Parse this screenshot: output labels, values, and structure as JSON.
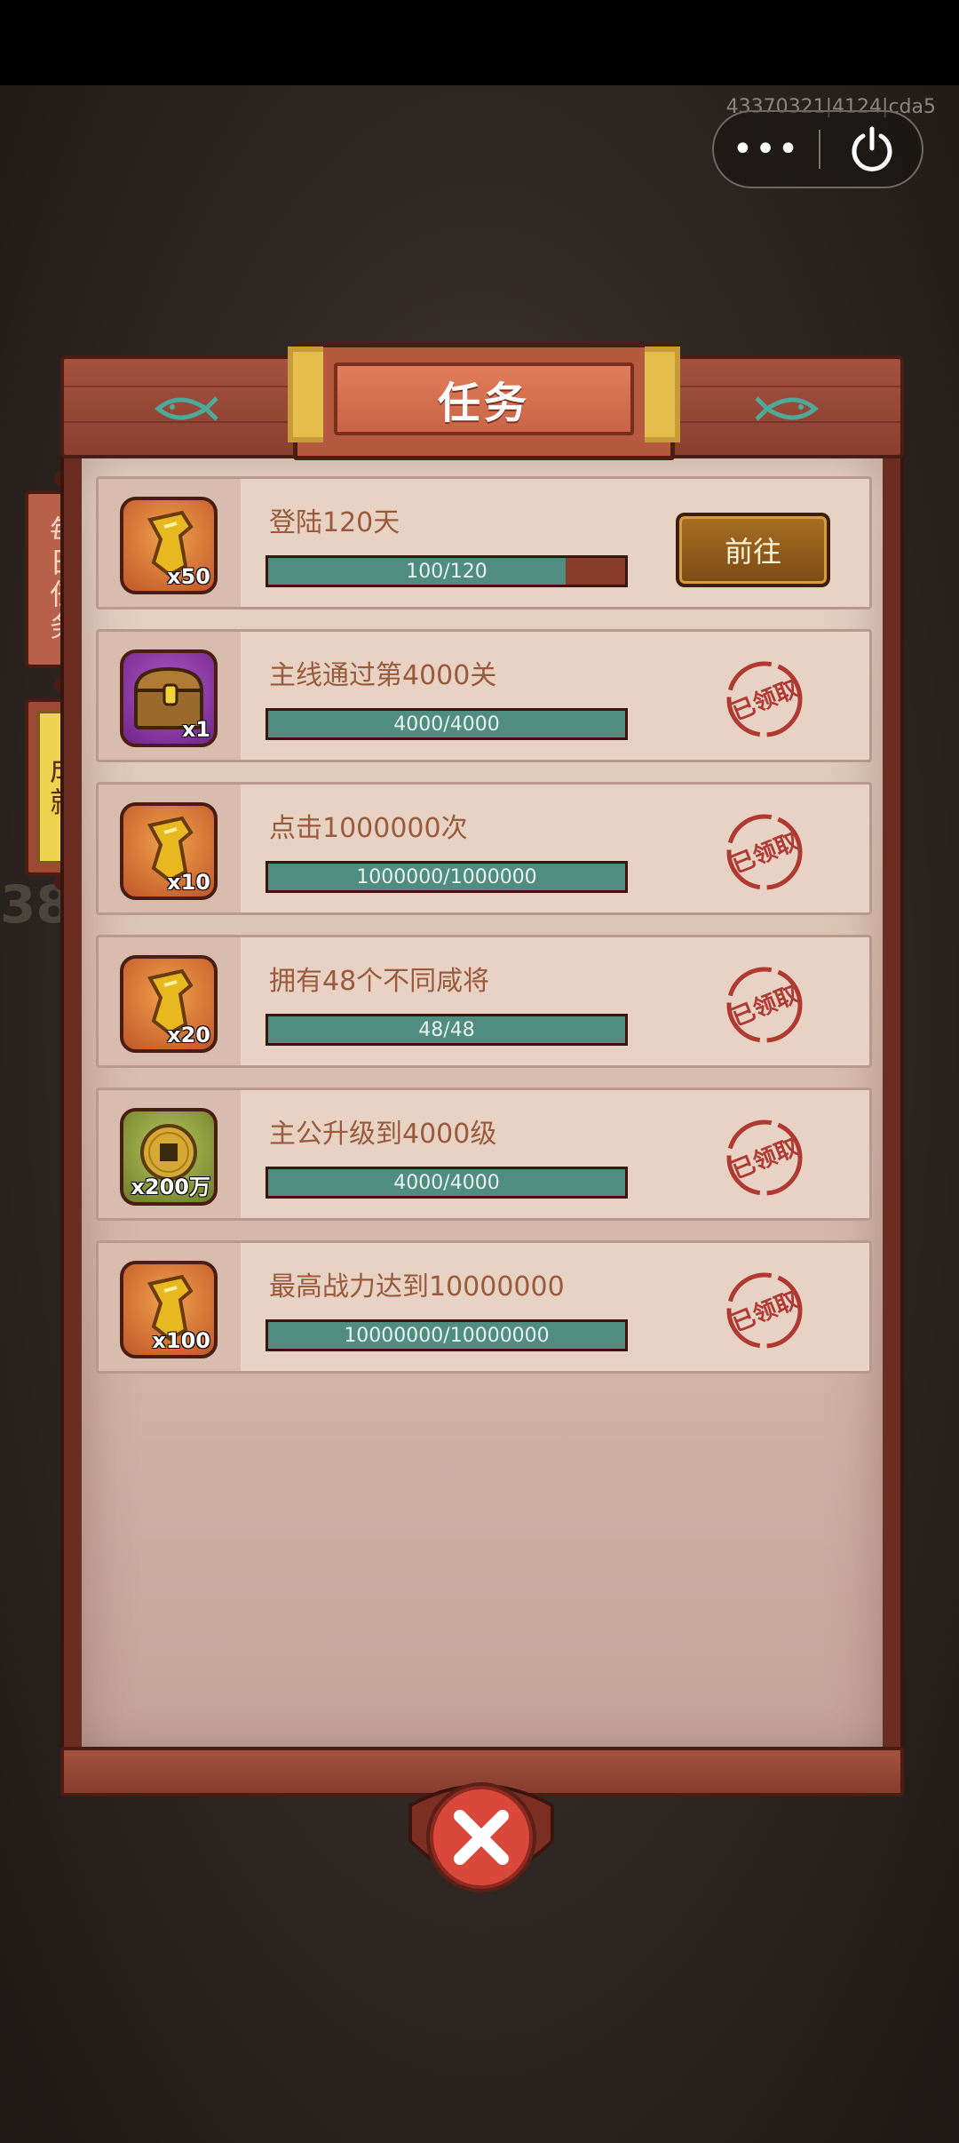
{
  "system": {
    "debug_id": "43370321|4124|cda5",
    "more_glyph": "•••"
  },
  "background": {
    "faded_number": "38"
  },
  "panel": {
    "title": "任务"
  },
  "tabs": [
    {
      "label": "每日任务",
      "active": false
    },
    {
      "label": "成就",
      "active": true
    }
  ],
  "tasks": [
    {
      "name": "登陆120天",
      "progress_text": "100/120",
      "progress": 0.8333,
      "reward_icon": "jade-token-icon",
      "reward_qty": "x50",
      "status": "go",
      "button_label": "前往"
    },
    {
      "name": "主线通过第4000关",
      "progress_text": "4000/4000",
      "progress": 1.0,
      "reward_icon": "treasure-chest-icon",
      "reward_qty": "x1",
      "status": "claimed",
      "stamp_text": "已领取"
    },
    {
      "name": "点击1000000次",
      "progress_text": "1000000/1000000",
      "progress": 1.0,
      "reward_icon": "jade-token-icon",
      "reward_qty": "x10",
      "status": "claimed",
      "stamp_text": "已领取"
    },
    {
      "name": "拥有48个不同咸将",
      "progress_text": "48/48",
      "progress": 1.0,
      "reward_icon": "jade-token-icon",
      "reward_qty": "x20",
      "status": "claimed",
      "stamp_text": "已领取"
    },
    {
      "name": "主公升级到4000级",
      "progress_text": "4000/4000",
      "progress": 1.0,
      "reward_icon": "copper-coin-icon",
      "reward_qty": "x200万",
      "status": "claimed",
      "stamp_text": "已领取"
    },
    {
      "name": "最高战力达到10000000",
      "progress_text": "10000000/10000000",
      "progress": 1.0,
      "reward_icon": "jade-token-icon",
      "reward_qty": "x100",
      "status": "claimed",
      "stamp_text": "已领取"
    }
  ],
  "colors": {
    "progress_fill": "#4e8d7f",
    "progress_empty": "#8a3b2a",
    "task_text": "#9a5a3c",
    "stamp": "#b03a32"
  }
}
